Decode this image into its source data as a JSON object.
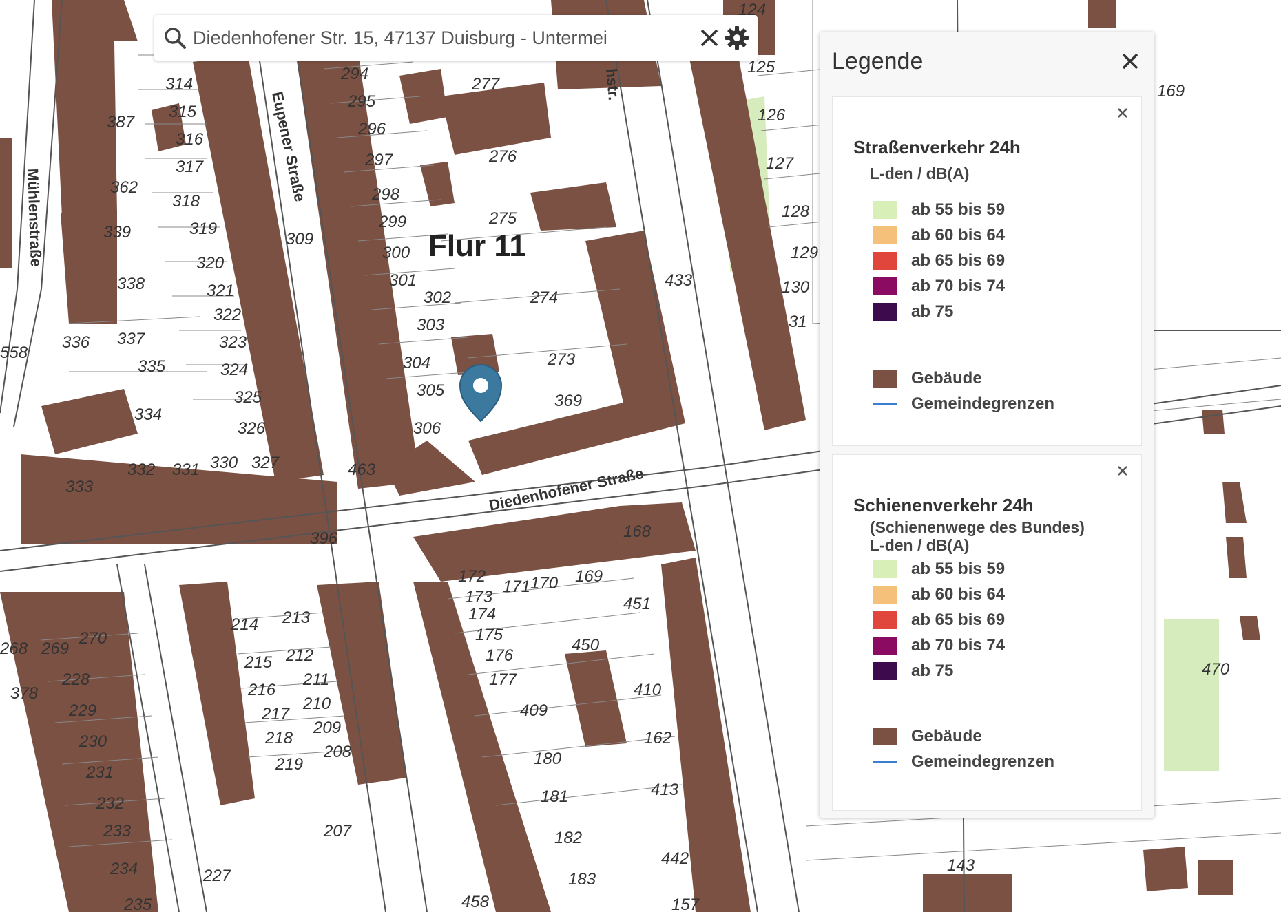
{
  "search": {
    "value": "Diedenhofener Str. 15, 47137 Duisburg - Untermei"
  },
  "map": {
    "flur_label": "Flur 11",
    "streets": {
      "eupener": "Eupener Straße",
      "muehlen": "Mühlenstraße",
      "diedenhofener": "Diedenhofener Straße",
      "hstr": "hstr."
    },
    "parcels": [
      "124",
      "125",
      "126",
      "127",
      "128",
      "129",
      "130",
      "31",
      "169",
      "433",
      "277",
      "276",
      "275",
      "274",
      "273",
      "369",
      "294",
      "295",
      "296",
      "297",
      "298",
      "299",
      "300",
      "301",
      "302",
      "303",
      "304",
      "305",
      "306",
      "309",
      "314",
      "315",
      "316",
      "317",
      "318",
      "319",
      "320",
      "321",
      "322",
      "323",
      "324",
      "325",
      "326",
      "327",
      "330",
      "331",
      "332",
      "333",
      "334",
      "335",
      "336",
      "337",
      "338",
      "339",
      "362",
      "387",
      "558",
      "396",
      "463",
      "168",
      "169",
      "170",
      "171",
      "172",
      "173",
      "174",
      "175",
      "176",
      "177",
      "451",
      "450",
      "410",
      "409",
      "180",
      "181",
      "182",
      "183",
      "162",
      "413",
      "442",
      "157",
      "458",
      "214",
      "213",
      "215",
      "212",
      "216",
      "211",
      "217",
      "210",
      "218",
      "209",
      "219",
      "208",
      "207",
      "227",
      "268",
      "269",
      "270",
      "228",
      "229",
      "230",
      "231",
      "232",
      "233",
      "234",
      "235",
      "378",
      "143",
      "470"
    ]
  },
  "legend": {
    "title": "Legende",
    "sections": [
      {
        "title": "Straßenverkehr 24h",
        "subtitle": "L-den / dB(A)",
        "items": [
          {
            "label": "ab 55 bis 59",
            "color": "#d8f0b8"
          },
          {
            "label": "ab 60 bis 64",
            "color": "#f5c07a"
          },
          {
            "label": "ab 65 bis 69",
            "color": "#e0463c"
          },
          {
            "label": "ab 70 bis 74",
            "color": "#8c0b62"
          },
          {
            "label": "ab 75",
            "color": "#3d0a4e"
          }
        ],
        "extra": [
          {
            "label": "Gebäude",
            "color": "#7b5143",
            "kind": "fill"
          },
          {
            "label": "Gemeindegrenzen",
            "color": "#3a7fd5",
            "kind": "line"
          }
        ]
      },
      {
        "title": "Schienenverkehr 24h",
        "subtitle": "(Schienenwege des Bundes)",
        "subtitle2": "L-den / dB(A)",
        "items": [
          {
            "label": "ab 55 bis 59",
            "color": "#d8f0b8"
          },
          {
            "label": "ab 60 bis 64",
            "color": "#f5c07a"
          },
          {
            "label": "ab 65 bis 69",
            "color": "#e0463c"
          },
          {
            "label": "ab 70 bis 74",
            "color": "#8c0b62"
          },
          {
            "label": "ab 75",
            "color": "#3d0a4e"
          }
        ],
        "extra": [
          {
            "label": "Gebäude",
            "color": "#7b5143",
            "kind": "fill"
          },
          {
            "label": "Gemeindegrenzen",
            "color": "#3a7fd5",
            "kind": "line"
          }
        ]
      }
    ]
  }
}
